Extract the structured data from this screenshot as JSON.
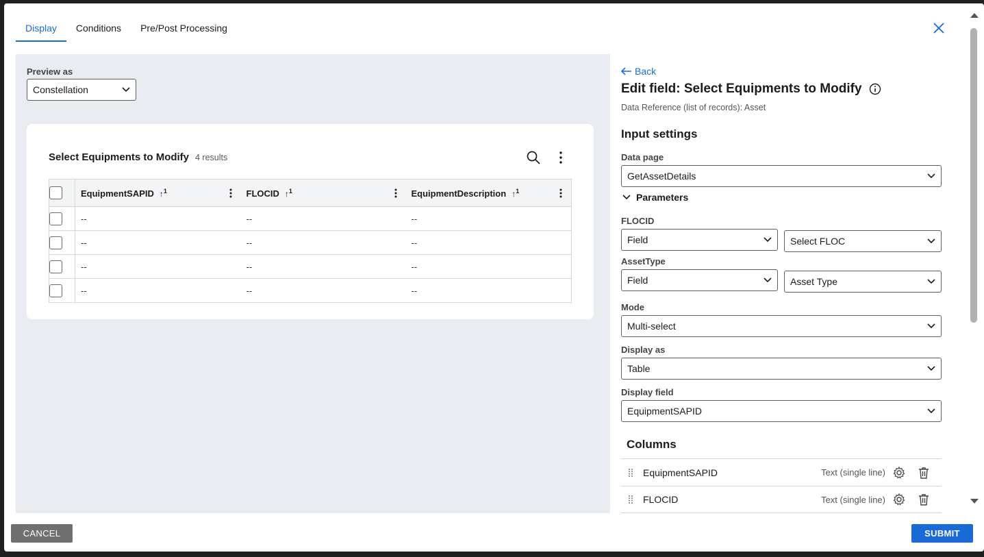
{
  "tabs": [
    {
      "label": "Display",
      "active": true
    },
    {
      "label": "Conditions",
      "active": false
    },
    {
      "label": "Pre/Post Processing",
      "active": false
    }
  ],
  "preview": {
    "label": "Preview as",
    "value": "Constellation"
  },
  "card": {
    "title": "Select Equipments to Modify",
    "count": "4 results",
    "columns": [
      {
        "label": "EquipmentSAPID",
        "sort": "1"
      },
      {
        "label": "FLOCID",
        "sort": "1"
      },
      {
        "label": "EquipmentDescription",
        "sort": "1"
      }
    ],
    "rows": [
      [
        "--",
        "--",
        "--"
      ],
      [
        "--",
        "--",
        "--"
      ],
      [
        "--",
        "--",
        "--"
      ],
      [
        "--",
        "--",
        "--"
      ]
    ]
  },
  "edit": {
    "back_label": "Back",
    "title": "Edit field: Select Equipments to Modify",
    "subtitle": "Data Reference (list of records): Asset",
    "input_settings": "Input settings",
    "data_page_label": "Data page",
    "data_page_value": "GetAssetDetails",
    "parameters_label": "Parameters",
    "flocid_label": "FLOCID",
    "flocid_source": "Field",
    "flocid_value": "Select FLOC",
    "assettype_label": "AssetType",
    "assettype_source": "Field",
    "assettype_value": "Asset Type",
    "mode_label": "Mode",
    "mode_value": "Multi-select",
    "display_as_label": "Display as",
    "display_as_value": "Table",
    "display_field_label": "Display field",
    "display_field_value": "EquipmentSAPID",
    "columns_label": "Columns",
    "columns": [
      {
        "name": "EquipmentSAPID",
        "type": "Text (single line)"
      },
      {
        "name": "FLOCID",
        "type": "Text (single line)"
      }
    ]
  },
  "footer": {
    "cancel": "CANCEL",
    "submit": "SUBMIT"
  },
  "colors": {
    "accent": "#1a6bd6",
    "preview_bg": "#e9edf2",
    "cancel_bg": "#707070"
  }
}
